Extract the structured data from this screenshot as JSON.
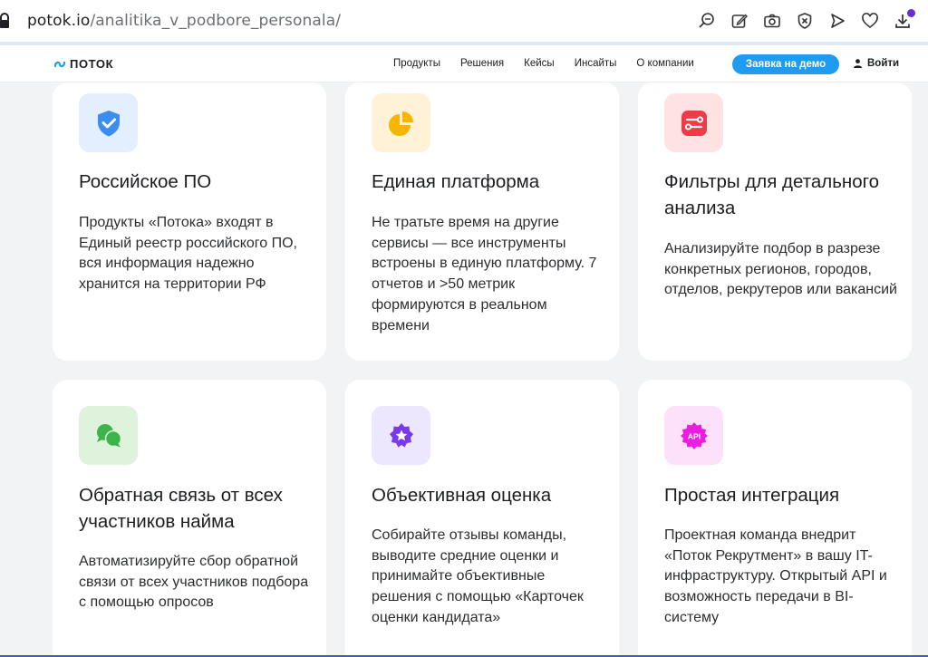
{
  "browser": {
    "url_host": "potok.io",
    "url_path": "/analitika_v_podbore_personala/",
    "icons": [
      "zoom-icon",
      "edit-icon",
      "camera-icon",
      "shield-x-icon",
      "send-icon",
      "heart-icon",
      "download-icon"
    ]
  },
  "header": {
    "logo": "ПОТОК",
    "nav": [
      "Продукты",
      "Решения",
      "Кейсы",
      "Инсайты",
      "О компании"
    ],
    "demo_button": "Заявка на демо",
    "login": "Войти"
  },
  "colors": {
    "accent": "#1f9bf2",
    "download_badge": "#6a2bd8"
  },
  "cards": [
    {
      "title": "Российское ПО",
      "text": "Продукты «Потока» входят в Единый реестр российского ПО, вся информация надежно хранится на территории РФ",
      "icon": "shield-check-icon",
      "icon_bg": "#e3efff",
      "icon_color": "#3a8ef0"
    },
    {
      "title": "Единая платформа",
      "text": "Не тратьте время на другие сервисы — все инструменты встроены в единую платформу. 7 отчетов и >50 метрик формируются в реальном времени",
      "icon": "pie-chart-icon",
      "icon_bg": "#fff2d6",
      "icon_color": "#f7b500"
    },
    {
      "title": "Фильтры для детального анализа",
      "text": "Анализируйте подбор в разрезе конкретных регионов, городов, отделов, рекрутеров или вакансий",
      "icon": "filter-sliders-icon",
      "icon_bg": "#ffe3e3",
      "icon_color": "#ef3b47"
    },
    {
      "title": "Обратная связь от всех участников найма",
      "text": "Автоматизируйте сбор обратной связи от всех участников подбора с помощью опросов",
      "icon": "chat-bubbles-icon",
      "icon_bg": "#dff3dc",
      "icon_color": "#3cb44a"
    },
    {
      "title": "Объективная оценка",
      "text": "Собирайте отзывы команды, выводите средние оценки и принимайте объективные решения с помощью «Карточек оценки кандидата»",
      "icon": "star-badge-icon",
      "icon_bg": "#ece6ff",
      "icon_color": "#7a3ae8"
    },
    {
      "title": "Простая интеграция",
      "text": "Проектная команда внедрит «Поток Рекрутмент» в вашу IT-инфраструктуру. Открытый API и возможность передачи в BI-систему",
      "icon": "api-gear-icon",
      "icon_badge": "API",
      "icon_bg": "#fde1fb",
      "icon_color": "#e91ee0"
    }
  ]
}
